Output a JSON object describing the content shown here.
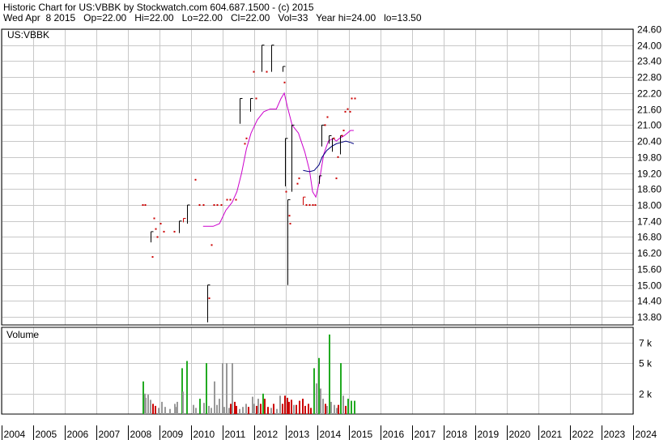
{
  "header": {
    "line1": "Historic Chart for US:VBBK by Stockwatch.com 604.687.1500 - (c) 2015",
    "line2": "Wed Apr  8 2015   Op=22.00   Hi=22.00   Lo=22.00   Cl=22.00   Vol=33   Year hi=24.00   lo=13.50"
  },
  "price_panel": {
    "label": "US:VBBK",
    "price_ticks": [
      "24.60",
      "24.00",
      "23.40",
      "22.80",
      "22.20",
      "21.60",
      "21.00",
      "20.40",
      "19.80",
      "19.20",
      "18.60",
      "18.00",
      "17.40",
      "16.80",
      "16.20",
      "15.60",
      "15.00",
      "14.40",
      "13.80"
    ]
  },
  "volume_panel": {
    "label": "Volume",
    "volume_ticks": [
      "7 k",
      "5 k",
      "2 k"
    ]
  },
  "x_axis": {
    "years": [
      "2004",
      "2005",
      "2006",
      "2007",
      "2008",
      "2009",
      "2010",
      "2011",
      "2012",
      "2013",
      "2014",
      "2015",
      "2016",
      "2017",
      "2018",
      "2019",
      "2020",
      "2021",
      "2022",
      "2023",
      "2024"
    ]
  },
  "colors": {
    "up": "#000000",
    "down": "#cc0000",
    "ma_long": "#cc00cc",
    "ma_short": "#000080",
    "vol_green": "#22aa22",
    "vol_gray": "#999999",
    "vol_red": "#cc0000",
    "grid": "#c8c8c8"
  },
  "chart_data": [
    {
      "type": "line",
      "title": "US:VBBK",
      "y_axis_position": "right",
      "ylim": [
        13.5,
        24.6
      ],
      "xlim": [
        2004.0,
        2024.0
      ],
      "grid": true,
      "candles": [
        {
          "x": 2008.45,
          "hi": 18.0,
          "lo": 18.0,
          "c": "down"
        },
        {
          "x": 2008.55,
          "hi": 18.0,
          "lo": 18.0,
          "c": "down"
        },
        {
          "x": 2008.72,
          "hi": 17.0,
          "lo": 16.6,
          "c": "up"
        },
        {
          "x": 2008.78,
          "hi": 16.05,
          "lo": 16.05,
          "c": "down"
        },
        {
          "x": 2008.82,
          "hi": 17.5,
          "lo": 17.5,
          "c": "down"
        },
        {
          "x": 2008.87,
          "hi": 17.1,
          "lo": 17.1,
          "c": "down"
        },
        {
          "x": 2008.92,
          "hi": 16.8,
          "lo": 16.8,
          "c": "down"
        },
        {
          "x": 2009.03,
          "hi": 17.3,
          "lo": 17.3,
          "c": "down"
        },
        {
          "x": 2009.12,
          "hi": 17.0,
          "lo": 16.95,
          "c": "down"
        },
        {
          "x": 2009.45,
          "hi": 17.0,
          "lo": 16.95,
          "c": "down"
        },
        {
          "x": 2009.62,
          "hi": 17.4,
          "lo": 16.95,
          "c": "up"
        },
        {
          "x": 2009.75,
          "hi": 17.5,
          "lo": 17.35,
          "c": "down"
        },
        {
          "x": 2009.88,
          "hi": 18.0,
          "lo": 17.3,
          "c": "up"
        },
        {
          "x": 2010.12,
          "hi": 18.95,
          "lo": 18.95,
          "c": "down"
        },
        {
          "x": 2010.25,
          "hi": 18.0,
          "lo": 18.0,
          "c": "down"
        },
        {
          "x": 2010.38,
          "hi": 18.0,
          "lo": 18.0,
          "c": "down"
        },
        {
          "x": 2010.52,
          "hi": 15.0,
          "lo": 13.6,
          "c": "up"
        },
        {
          "x": 2010.57,
          "hi": 14.5,
          "lo": 14.5,
          "c": "down"
        },
        {
          "x": 2010.63,
          "hi": 16.5,
          "lo": 16.5,
          "c": "down"
        },
        {
          "x": 2010.72,
          "hi": 18.0,
          "lo": 18.0,
          "c": "down"
        },
        {
          "x": 2010.82,
          "hi": 18.0,
          "lo": 18.0,
          "c": "down"
        },
        {
          "x": 2010.95,
          "hi": 18.0,
          "lo": 18.0,
          "c": "down"
        },
        {
          "x": 2011.12,
          "hi": 18.2,
          "lo": 18.2,
          "c": "down"
        },
        {
          "x": 2011.22,
          "hi": 18.2,
          "lo": 18.2,
          "c": "down"
        },
        {
          "x": 2011.42,
          "hi": 18.2,
          "lo": 18.2,
          "c": "down"
        },
        {
          "x": 2011.55,
          "hi": 22.0,
          "lo": 21.05,
          "c": "up"
        },
        {
          "x": 2011.68,
          "hi": 20.3,
          "lo": 20.3,
          "c": "down"
        },
        {
          "x": 2011.75,
          "hi": 20.5,
          "lo": 20.5,
          "c": "down"
        },
        {
          "x": 2011.88,
          "hi": 22.0,
          "lo": 21.5,
          "c": "up"
        },
        {
          "x": 2011.98,
          "hi": 23.0,
          "lo": 23.0,
          "c": "down"
        },
        {
          "x": 2012.05,
          "hi": 22.0,
          "lo": 22.0,
          "c": "down"
        },
        {
          "x": 2012.22,
          "hi": 24.0,
          "lo": 23.0,
          "c": "up"
        },
        {
          "x": 2012.38,
          "hi": 23.0,
          "lo": 23.0,
          "c": "down"
        },
        {
          "x": 2012.55,
          "hi": 24.0,
          "lo": 23.0,
          "c": "up"
        },
        {
          "x": 2012.9,
          "hi": 23.2,
          "lo": 23.0,
          "c": "up"
        },
        {
          "x": 2012.95,
          "hi": 22.6,
          "lo": 22.6,
          "c": "down"
        },
        {
          "x": 2012.97,
          "hi": 20.5,
          "lo": 18.7,
          "c": "up"
        },
        {
          "x": 2013.0,
          "hi": 18.5,
          "lo": 18.5,
          "c": "down"
        },
        {
          "x": 2013.05,
          "hi": 18.2,
          "lo": 15.0,
          "c": "up"
        },
        {
          "x": 2013.1,
          "hi": 17.6,
          "lo": 17.6,
          "c": "down"
        },
        {
          "x": 2013.12,
          "hi": 17.3,
          "lo": 17.3,
          "c": "down"
        },
        {
          "x": 2013.18,
          "hi": 21.0,
          "lo": 18.5,
          "c": "up"
        },
        {
          "x": 2013.35,
          "hi": 18.8,
          "lo": 18.8,
          "c": "down"
        },
        {
          "x": 2013.42,
          "hi": 19.0,
          "lo": 19.0,
          "c": "down"
        },
        {
          "x": 2013.55,
          "hi": 18.3,
          "lo": 18.0,
          "c": "down"
        },
        {
          "x": 2013.65,
          "hi": 18.0,
          "lo": 18.0,
          "c": "down"
        },
        {
          "x": 2013.75,
          "hi": 18.0,
          "lo": 18.0,
          "c": "down"
        },
        {
          "x": 2013.85,
          "hi": 18.0,
          "lo": 18.0,
          "c": "down"
        },
        {
          "x": 2013.92,
          "hi": 18.0,
          "lo": 18.0,
          "c": "down"
        },
        {
          "x": 2014.05,
          "hi": 19.1,
          "lo": 18.8,
          "c": "up"
        },
        {
          "x": 2014.12,
          "hi": 21.0,
          "lo": 20.2,
          "c": "up"
        },
        {
          "x": 2014.22,
          "hi": 21.0,
          "lo": 21.0,
          "c": "down"
        },
        {
          "x": 2014.3,
          "hi": 21.3,
          "lo": 21.3,
          "c": "down"
        },
        {
          "x": 2014.35,
          "hi": 20.6,
          "lo": 20.3,
          "c": "up"
        },
        {
          "x": 2014.45,
          "hi": 20.5,
          "lo": 20.0,
          "c": "up"
        },
        {
          "x": 2014.52,
          "hi": 20.5,
          "lo": 20.5,
          "c": "down"
        },
        {
          "x": 2014.58,
          "hi": 19.0,
          "lo": 19.0,
          "c": "down"
        },
        {
          "x": 2014.65,
          "hi": 19.8,
          "lo": 19.8,
          "c": "down"
        },
        {
          "x": 2014.72,
          "hi": 20.6,
          "lo": 19.9,
          "c": "up"
        },
        {
          "x": 2014.78,
          "hi": 20.6,
          "lo": 20.6,
          "c": "down"
        },
        {
          "x": 2014.82,
          "hi": 20.8,
          "lo": 20.8,
          "c": "down"
        },
        {
          "x": 2014.88,
          "hi": 21.5,
          "lo": 21.5,
          "c": "down"
        },
        {
          "x": 2014.95,
          "hi": 21.6,
          "lo": 21.6,
          "c": "down"
        },
        {
          "x": 2015.02,
          "hi": 21.5,
          "lo": 21.5,
          "c": "down"
        },
        {
          "x": 2015.08,
          "hi": 22.0,
          "lo": 22.0,
          "c": "down"
        },
        {
          "x": 2015.18,
          "hi": 22.0,
          "lo": 22.0,
          "c": "down"
        }
      ],
      "series": [
        {
          "x": [
            2010.38,
            2010.5,
            2010.7,
            2010.9,
            2011.1,
            2011.3,
            2011.45,
            2011.6,
            2011.75,
            2011.9,
            2012.1,
            2012.3,
            2012.5,
            2012.7,
            2012.85,
            2012.95,
            2013.05,
            2013.2,
            2013.4,
            2013.6,
            2013.75,
            2013.85,
            2013.95,
            2014.05,
            2014.2,
            2014.35,
            2014.5,
            2014.6,
            2014.7,
            2014.85,
            2014.95,
            2015.05,
            2015.15
          ],
          "y": [
            17.2,
            17.2,
            17.2,
            17.3,
            17.8,
            18.1,
            18.5,
            19.2,
            20.1,
            20.7,
            21.2,
            21.5,
            21.6,
            21.6,
            22.0,
            22.2,
            21.7,
            21.0,
            20.7,
            20.0,
            19.3,
            18.5,
            18.3,
            18.8,
            19.9,
            20.4,
            20.5,
            20.4,
            20.5,
            20.6,
            20.7,
            20.8,
            20.8
          ]
        },
        {
          "x": [
            2013.55,
            2013.75,
            2013.9,
            2014.05,
            2014.15,
            2014.3,
            2014.45,
            2014.6,
            2014.75,
            2014.9,
            2015.05,
            2015.15
          ],
          "y": [
            19.3,
            19.25,
            19.3,
            19.5,
            19.8,
            20.05,
            20.2,
            20.3,
            20.35,
            20.4,
            20.35,
            20.3
          ]
        }
      ]
    },
    {
      "type": "bar",
      "title": "Volume",
      "ylim": [
        0,
        8.5
      ],
      "volumes": [
        {
          "x": 2008.45,
          "v": 3.2,
          "c": "green"
        },
        {
          "x": 2008.5,
          "v": 2.0,
          "c": "gray"
        },
        {
          "x": 2008.55,
          "v": 1.6,
          "c": "gray"
        },
        {
          "x": 2008.62,
          "v": 1.9,
          "c": "gray"
        },
        {
          "x": 2008.7,
          "v": 1.4,
          "c": "gray"
        },
        {
          "x": 2008.78,
          "v": 1.0,
          "c": "red"
        },
        {
          "x": 2008.85,
          "v": 0.8,
          "c": "red"
        },
        {
          "x": 2008.95,
          "v": 0.6,
          "c": "gray"
        },
        {
          "x": 2009.05,
          "v": 1.2,
          "c": "gray"
        },
        {
          "x": 2009.15,
          "v": 0.7,
          "c": "gray"
        },
        {
          "x": 2009.3,
          "v": 0.5,
          "c": "gray"
        },
        {
          "x": 2009.45,
          "v": 1.0,
          "c": "gray"
        },
        {
          "x": 2009.5,
          "v": 0.7,
          "c": "gray"
        },
        {
          "x": 2009.55,
          "v": 1.2,
          "c": "gray"
        },
        {
          "x": 2009.68,
          "v": 4.5,
          "c": "green"
        },
        {
          "x": 2009.72,
          "v": 2.2,
          "c": "gray"
        },
        {
          "x": 2009.85,
          "v": 5.2,
          "c": "green"
        },
        {
          "x": 2010.05,
          "v": 0.9,
          "c": "gray"
        },
        {
          "x": 2010.12,
          "v": 0.6,
          "c": "gray"
        },
        {
          "x": 2010.25,
          "v": 1.5,
          "c": "green"
        },
        {
          "x": 2010.38,
          "v": 1.1,
          "c": "gray"
        },
        {
          "x": 2010.45,
          "v": 5.0,
          "c": "green"
        },
        {
          "x": 2010.55,
          "v": 0.8,
          "c": "gray"
        },
        {
          "x": 2010.62,
          "v": 0.6,
          "c": "gray"
        },
        {
          "x": 2010.72,
          "v": 3.2,
          "c": "gray"
        },
        {
          "x": 2010.8,
          "v": 0.9,
          "c": "gray"
        },
        {
          "x": 2010.88,
          "v": 1.5,
          "c": "gray"
        },
        {
          "x": 2010.98,
          "v": 5.0,
          "c": "gray"
        },
        {
          "x": 2011.02,
          "v": 0.7,
          "c": "gray"
        },
        {
          "x": 2011.1,
          "v": 5.0,
          "c": "gray"
        },
        {
          "x": 2011.18,
          "v": 0.6,
          "c": "gray"
        },
        {
          "x": 2011.22,
          "v": 1.0,
          "c": "red"
        },
        {
          "x": 2011.28,
          "v": 5.0,
          "c": "gray"
        },
        {
          "x": 2011.35,
          "v": 1.2,
          "c": "red"
        },
        {
          "x": 2011.42,
          "v": 0.8,
          "c": "red"
        },
        {
          "x": 2011.5,
          "v": 0.5,
          "c": "gray"
        },
        {
          "x": 2011.62,
          "v": 0.7,
          "c": "gray"
        },
        {
          "x": 2011.72,
          "v": 1.0,
          "c": "gray"
        },
        {
          "x": 2011.8,
          "v": 0.7,
          "c": "red"
        },
        {
          "x": 2011.92,
          "v": 1.7,
          "c": "gray"
        },
        {
          "x": 2011.98,
          "v": 1.0,
          "c": "gray"
        },
        {
          "x": 2012.05,
          "v": 0.8,
          "c": "red"
        },
        {
          "x": 2012.1,
          "v": 1.5,
          "c": "gray"
        },
        {
          "x": 2012.18,
          "v": 1.0,
          "c": "red"
        },
        {
          "x": 2012.25,
          "v": 2.0,
          "c": "green"
        },
        {
          "x": 2012.32,
          "v": 1.5,
          "c": "red"
        },
        {
          "x": 2012.4,
          "v": 0.7,
          "c": "red"
        },
        {
          "x": 2012.5,
          "v": 0.6,
          "c": "gray"
        },
        {
          "x": 2012.6,
          "v": 1.0,
          "c": "red"
        },
        {
          "x": 2012.68,
          "v": 0.5,
          "c": "gray"
        },
        {
          "x": 2012.8,
          "v": 1.8,
          "c": "gray"
        },
        {
          "x": 2012.88,
          "v": 1.0,
          "c": "red"
        },
        {
          "x": 2012.95,
          "v": 1.8,
          "c": "red"
        },
        {
          "x": 2013.02,
          "v": 1.6,
          "c": "red"
        },
        {
          "x": 2013.08,
          "v": 1.2,
          "c": "red"
        },
        {
          "x": 2013.15,
          "v": 1.4,
          "c": "red"
        },
        {
          "x": 2013.22,
          "v": 0.9,
          "c": "gray"
        },
        {
          "x": 2013.32,
          "v": 0.9,
          "c": "red"
        },
        {
          "x": 2013.42,
          "v": 1.3,
          "c": "red"
        },
        {
          "x": 2013.5,
          "v": 1.5,
          "c": "red"
        },
        {
          "x": 2013.58,
          "v": 0.8,
          "c": "red"
        },
        {
          "x": 2013.7,
          "v": 1.0,
          "c": "red"
        },
        {
          "x": 2013.78,
          "v": 0.6,
          "c": "red"
        },
        {
          "x": 2013.88,
          "v": 4.5,
          "c": "green"
        },
        {
          "x": 2013.95,
          "v": 3.0,
          "c": "gray"
        },
        {
          "x": 2014.02,
          "v": 5.5,
          "c": "green"
        },
        {
          "x": 2014.08,
          "v": 2.5,
          "c": "gray"
        },
        {
          "x": 2014.15,
          "v": 1.5,
          "c": "gray"
        },
        {
          "x": 2014.22,
          "v": 1.0,
          "c": "red"
        },
        {
          "x": 2014.28,
          "v": 0.8,
          "c": "gray"
        },
        {
          "x": 2014.35,
          "v": 7.8,
          "c": "green"
        },
        {
          "x": 2014.42,
          "v": 1.2,
          "c": "gray"
        },
        {
          "x": 2014.5,
          "v": 0.9,
          "c": "gray"
        },
        {
          "x": 2014.58,
          "v": 0.6,
          "c": "gray"
        },
        {
          "x": 2014.65,
          "v": 0.9,
          "c": "red"
        },
        {
          "x": 2014.72,
          "v": 5.0,
          "c": "green"
        },
        {
          "x": 2014.8,
          "v": 1.8,
          "c": "gray"
        },
        {
          "x": 2014.88,
          "v": 0.8,
          "c": "red"
        },
        {
          "x": 2014.95,
          "v": 1.5,
          "c": "green"
        },
        {
          "x": 2015.05,
          "v": 1.3,
          "c": "green"
        },
        {
          "x": 2015.15,
          "v": 1.3,
          "c": "green"
        }
      ]
    }
  ]
}
